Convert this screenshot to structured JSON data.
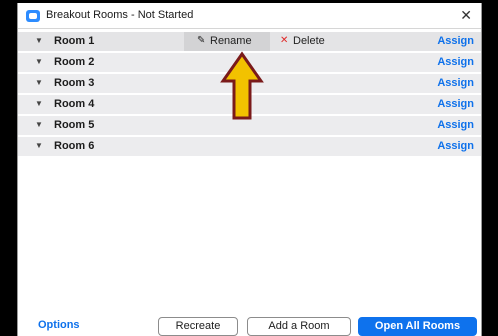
{
  "window": {
    "title": "Breakout Rooms - Not Started",
    "close_glyph": "✕"
  },
  "rooms": [
    {
      "name": "Room 1",
      "assign": "Assign"
    },
    {
      "name": "Room 2",
      "assign": "Assign"
    },
    {
      "name": "Room 3",
      "assign": "Assign"
    },
    {
      "name": "Room 4",
      "assign": "Assign"
    },
    {
      "name": "Room 5",
      "assign": "Assign"
    },
    {
      "name": "Room 6",
      "assign": "Assign"
    }
  ],
  "row_actions": {
    "rename_label": "Rename",
    "delete_label": "Delete"
  },
  "footer": {
    "options_label": "Options",
    "recreate_label": "Recreate",
    "add_room_label": "Add a Room",
    "open_all_label": "Open All Rooms"
  },
  "icons": {
    "app": "zoom-app-icon",
    "caret": "caret-down-icon",
    "rename": "pencil-icon",
    "delete": "x-icon",
    "annotation": "up-arrow-icon"
  },
  "colors": {
    "accent_blue": "#0e71eb",
    "open_button": "#0e72ed",
    "delete_red": "#e02828",
    "arrow_fill": "#f2c200",
    "arrow_outline": "#7a1a1a"
  }
}
